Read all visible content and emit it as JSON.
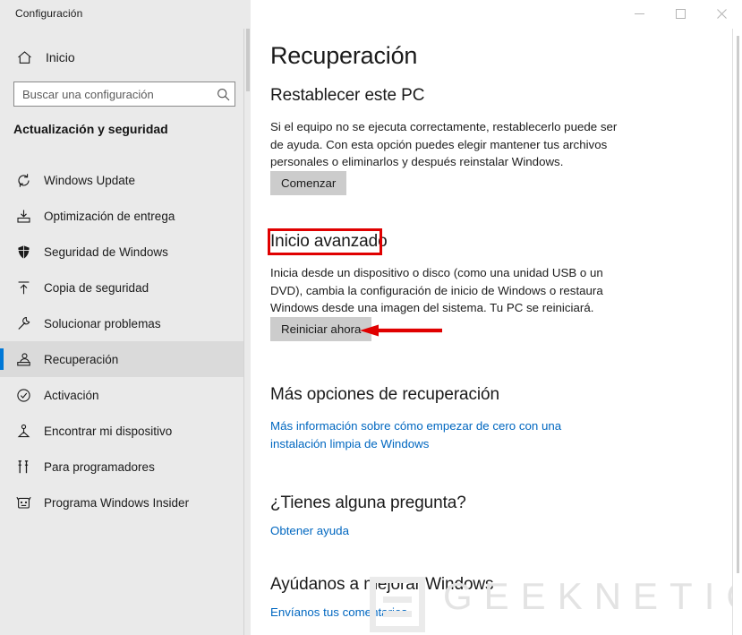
{
  "window": {
    "caption": "Configuración",
    "controls": [
      {
        "name": "minimize",
        "glyph": "minimize-icon"
      },
      {
        "name": "maximize",
        "glyph": "maximize-icon"
      },
      {
        "name": "close",
        "glyph": "close-icon"
      }
    ]
  },
  "sidebar": {
    "home": {
      "label": "Inicio",
      "icon": "home-icon"
    },
    "search": {
      "value": "",
      "placeholder": "Buscar una configuración",
      "icon": "search-icon"
    },
    "group_title": "Actualización y seguridad",
    "items": [
      {
        "label": "Windows Update",
        "icon": "sync-icon",
        "selected": false
      },
      {
        "label": "Optimización de entrega",
        "icon": "delivery-optimization-icon",
        "selected": false
      },
      {
        "label": "Seguridad de Windows",
        "icon": "shield-icon",
        "selected": false
      },
      {
        "label": "Copia de seguridad",
        "icon": "backup-upload-icon",
        "selected": false
      },
      {
        "label": "Solucionar problemas",
        "icon": "wrench-icon",
        "selected": false
      },
      {
        "label": "Recuperación",
        "icon": "recovery-icon",
        "selected": true
      },
      {
        "label": "Activación",
        "icon": "check-circle-icon",
        "selected": false
      },
      {
        "label": "Encontrar mi dispositivo",
        "icon": "find-device-icon",
        "selected": false
      },
      {
        "label": "Para programadores",
        "icon": "developer-tools-icon",
        "selected": false
      },
      {
        "label": "Programa Windows Insider",
        "icon": "insider-icon",
        "selected": false
      }
    ]
  },
  "main": {
    "page_title": "Recuperación",
    "sections": {
      "reset_pc": {
        "heading": "Restablecer este PC",
        "body": "Si el equipo no se ejecuta correctamente, restablecerlo puede ser de ayuda. Con esta opción puedes elegir mantener tus archivos personales o eliminarlos y después reinstalar Windows.",
        "button": "Comenzar"
      },
      "advanced_startup": {
        "heading": "Inicio avanzado",
        "body": "Inicia desde un dispositivo o disco (como una unidad USB o un DVD), cambia la configuración de inicio de Windows o restaura Windows desde una imagen del sistema. Tu PC se reiniciará.",
        "button": "Reiniciar ahora"
      },
      "more_recovery": {
        "heading": "Más opciones de recuperación",
        "link": "Más información sobre cómo empezar de cero con una instalación limpia de Windows"
      },
      "questions": {
        "heading": "¿Tienes alguna pregunta?",
        "link": "Obtener ayuda"
      },
      "improve_windows": {
        "heading": "Ayúdanos a mejorar Windows",
        "link": "Envíanos tus comentarios"
      }
    }
  },
  "annotations": {
    "highlight_color": "#e00000",
    "accent_color": "#0078d7",
    "heading_box_target": "Inicio avanzado",
    "arrow_target": "Reiniciar ahora"
  },
  "watermark": {
    "text": "GEEKNETIC"
  }
}
